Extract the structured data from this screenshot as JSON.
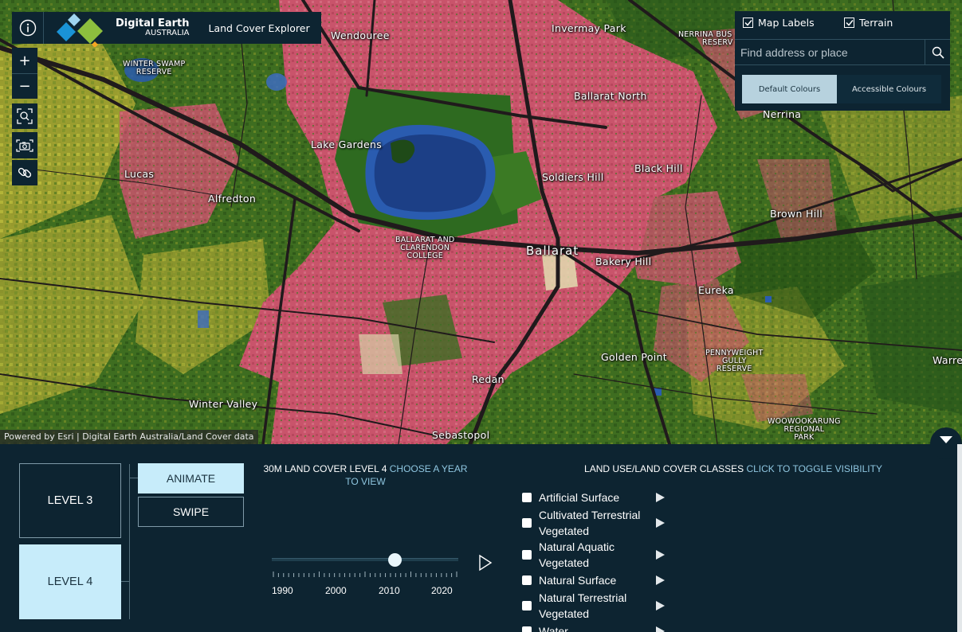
{
  "header": {
    "brand_line1": "Digital Earth",
    "brand_line2": "AUSTRALIA",
    "app_title": "Land Cover Explorer"
  },
  "map": {
    "attribution": "Powered by Esri | Digital Earth Australia/Land Cover data",
    "places": {
      "wendouree": "Wendouree",
      "invermay_park": "Invermay Park",
      "nerrina_bushland_l1": "NERRINA BUS",
      "nerrina_bushland_l2": "RESERV",
      "winter_swamp_l1": "WINTER SWAMP",
      "winter_swamp_l2": "RESERVE",
      "ballarat_north": "Ballarat North",
      "nerrina": "Nerrina",
      "lake_gardens": "Lake Gardens",
      "lucas": "Lucas",
      "soldiers_hill": "Soldiers Hill",
      "black_hill": "Black Hill",
      "alfredton": "Alfredton",
      "brown_hill": "Brown Hill",
      "college_l1": "BALLARAT AND",
      "college_l2": "CLARENDON",
      "college_l3": "COLLEGE",
      "ballarat": "Ballarat",
      "bakery_hill": "Bakery Hill",
      "eureka": "Eureka",
      "golden_point": "Golden Point",
      "pennyweight_l1": "PENNYWEIGHT",
      "pennyweight_l2": "GULLY",
      "pennyweight_l3": "RESERVE",
      "warrenheip": "Warre",
      "redan": "Redan",
      "winter_valley": "Winter Valley",
      "sebastopol": "Sebastopol",
      "woowookarung_l1": "WOOWOOKARUNG",
      "woowookarung_l2": "REGIONAL",
      "woowookarung_l3": "PARK"
    }
  },
  "controls": {
    "zoom_in": "+",
    "zoom_out": "−"
  },
  "right_panel": {
    "map_labels": "Map Labels",
    "terrain": "Terrain",
    "search_placeholder": "Find address or place",
    "default_colours": "Default Colours",
    "accessible_colours": "Accessible Colours"
  },
  "panel": {
    "level3": "LEVEL 3",
    "level4": "LEVEL 4",
    "animate": "ANIMATE",
    "swipe": "SWIPE",
    "layer_title_white": "30M LAND COVER LEVEL 4",
    "layer_title_hint": "CHOOSE A YEAR TO VIEW",
    "classes_title_white": "LAND USE/LAND COVER CLASSES",
    "classes_title_hint": "CLICK TO TOGGLE VISIBILITY",
    "year_axis": [
      "1990",
      "2000",
      "2010",
      "2020"
    ],
    "selected_year_fraction": 0.66,
    "classes": [
      {
        "line1": "Artificial Surface",
        "line2": ""
      },
      {
        "line1": "Cultivated Terrestrial",
        "line2": "Vegetated"
      },
      {
        "line1": "Natural Aquatic",
        "line2": "Vegetated"
      },
      {
        "line1": "Natural Surface",
        "line2": ""
      },
      {
        "line1": "Natural Terrestrial",
        "line2": "Vegetated"
      },
      {
        "line1": "Water",
        "line2": ""
      }
    ]
  },
  "colors": {
    "panel_bg": "#0d2431",
    "accent": "#c7ecfa",
    "artificial": "#c9546b",
    "cultivated": "#c6c03a",
    "natural_terrestrial": "#2f6b1c",
    "water": "#1f4fa0"
  }
}
